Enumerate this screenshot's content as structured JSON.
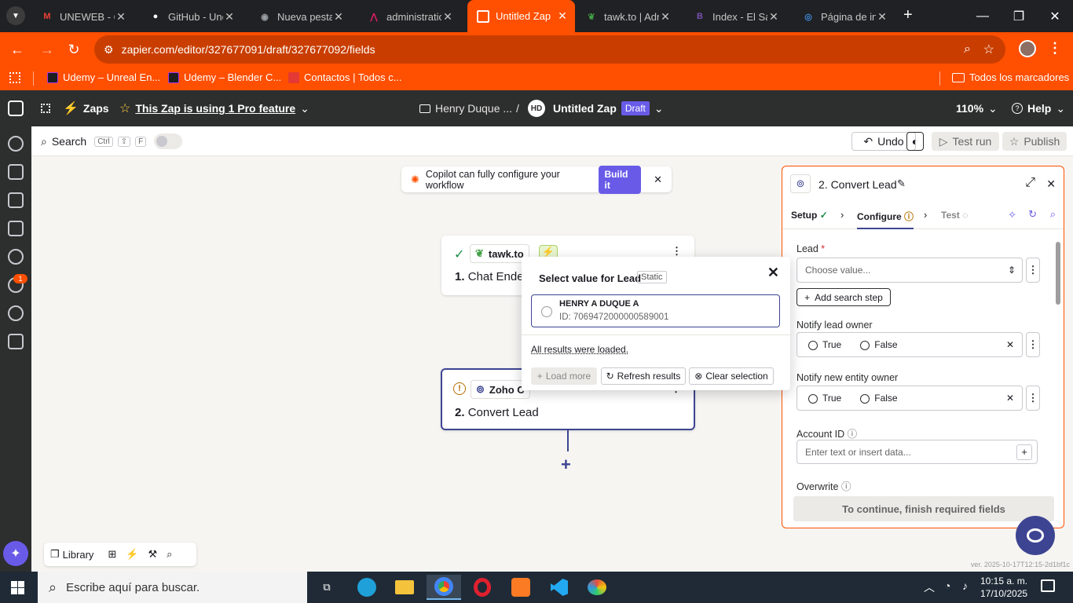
{
  "tabs": [
    {
      "label": "UNEWEB - C",
      "icon": "gmail-icon",
      "color": "#ea4335",
      "glyph": "M"
    },
    {
      "label": "GitHub - Une",
      "icon": "github-icon",
      "color": "#ffffff",
      "glyph": ""
    },
    {
      "label": "Nueva pesta",
      "icon": "chrome-icon",
      "color": "#9aa0a6",
      "glyph": ""
    },
    {
      "label": "administratio",
      "icon": "mixpanel-icon",
      "color": "#e91e63",
      "glyph": ""
    },
    {
      "label": "Untitled Zap",
      "icon": "zapier-icon",
      "color": "#ffffff",
      "glyph": ""
    },
    {
      "label": "tawk.to | Adr",
      "icon": "tawk-icon",
      "color": "#43a047",
      "glyph": ""
    },
    {
      "label": "Index - El Sa",
      "icon": "bootstrap-icon",
      "color": "#7952b3",
      "glyph": "B"
    },
    {
      "label": "Página de in",
      "icon": "edge-icon",
      "color": "#3f87d6",
      "glyph": ""
    }
  ],
  "address": {
    "url": "zapier.com/editor/327677091/draft/327677092/fields"
  },
  "bookmarks": [
    {
      "label": "Udemy – Unreal En...",
      "icon": "udemy-icon"
    },
    {
      "label": "Udemy – Blender C...",
      "icon": "udemy-icon"
    },
    {
      "label": "Contactos | Todos c...",
      "icon": "contacts-icon"
    }
  ],
  "bookmarks_all": "Todos los marcadores",
  "header": {
    "zaps": "Zaps",
    "pro_feature": "This Zap is using 1 Pro feature",
    "folder": "Henry Duque ...",
    "separator": "/",
    "avatar": "HD",
    "zap_name": "Untitled Zap",
    "draft": "Draft",
    "zoom": "110%",
    "help": "Help"
  },
  "rail": {
    "badge": "1"
  },
  "toolbar": {
    "search": "Search",
    "shortcut": [
      "Ctrl",
      "⇧",
      "F"
    ],
    "undo": "Undo",
    "test_run": "Test run",
    "publish": "Publish"
  },
  "copilot": {
    "text": "Copilot can fully configure your workflow",
    "button": "Build it"
  },
  "step1": {
    "app": "tawk.to",
    "title": "1.",
    "name": "Chat Ended"
  },
  "step2": {
    "app": "Zoho C",
    "title": "2.",
    "name": "Convert Lead"
  },
  "dropdown": {
    "title": "Select value for Lead",
    "tag": "Static",
    "option_name": "HENRY A DUQUE A",
    "option_id": "ID: 7069472000000589001",
    "loaded": "All results were loaded.",
    "load_more": "Load more",
    "refresh": "Refresh results",
    "clear": "Clear selection"
  },
  "panel": {
    "title": "2. Convert Lead",
    "tabs": {
      "setup": "Setup",
      "configure": "Configure",
      "test": "Test"
    },
    "lead_label": "Lead",
    "required_mark": "*",
    "lead_placeholder": "Choose value...",
    "add_search": "Add search step",
    "notify_owner": "Notify lead owner",
    "notify_entity": "Notify new entity owner",
    "true_label": "True",
    "false_label": "False",
    "account_id": "Account ID",
    "account_placeholder": "Enter text or insert data...",
    "overwrite": "Overwrite",
    "continue": "To continue, finish required fields"
  },
  "bottom": {
    "library": "Library"
  },
  "version": "ver. 2025-10-17T12:15-2d1bf1c",
  "taskbar": {
    "search": "Escribe aquí para buscar.",
    "time": "10:15 a. m.",
    "date": "17/10/2025"
  },
  "colors": {
    "brand": "#ff4f00",
    "purple": "#695be8",
    "border_purple": "#3d4592"
  }
}
